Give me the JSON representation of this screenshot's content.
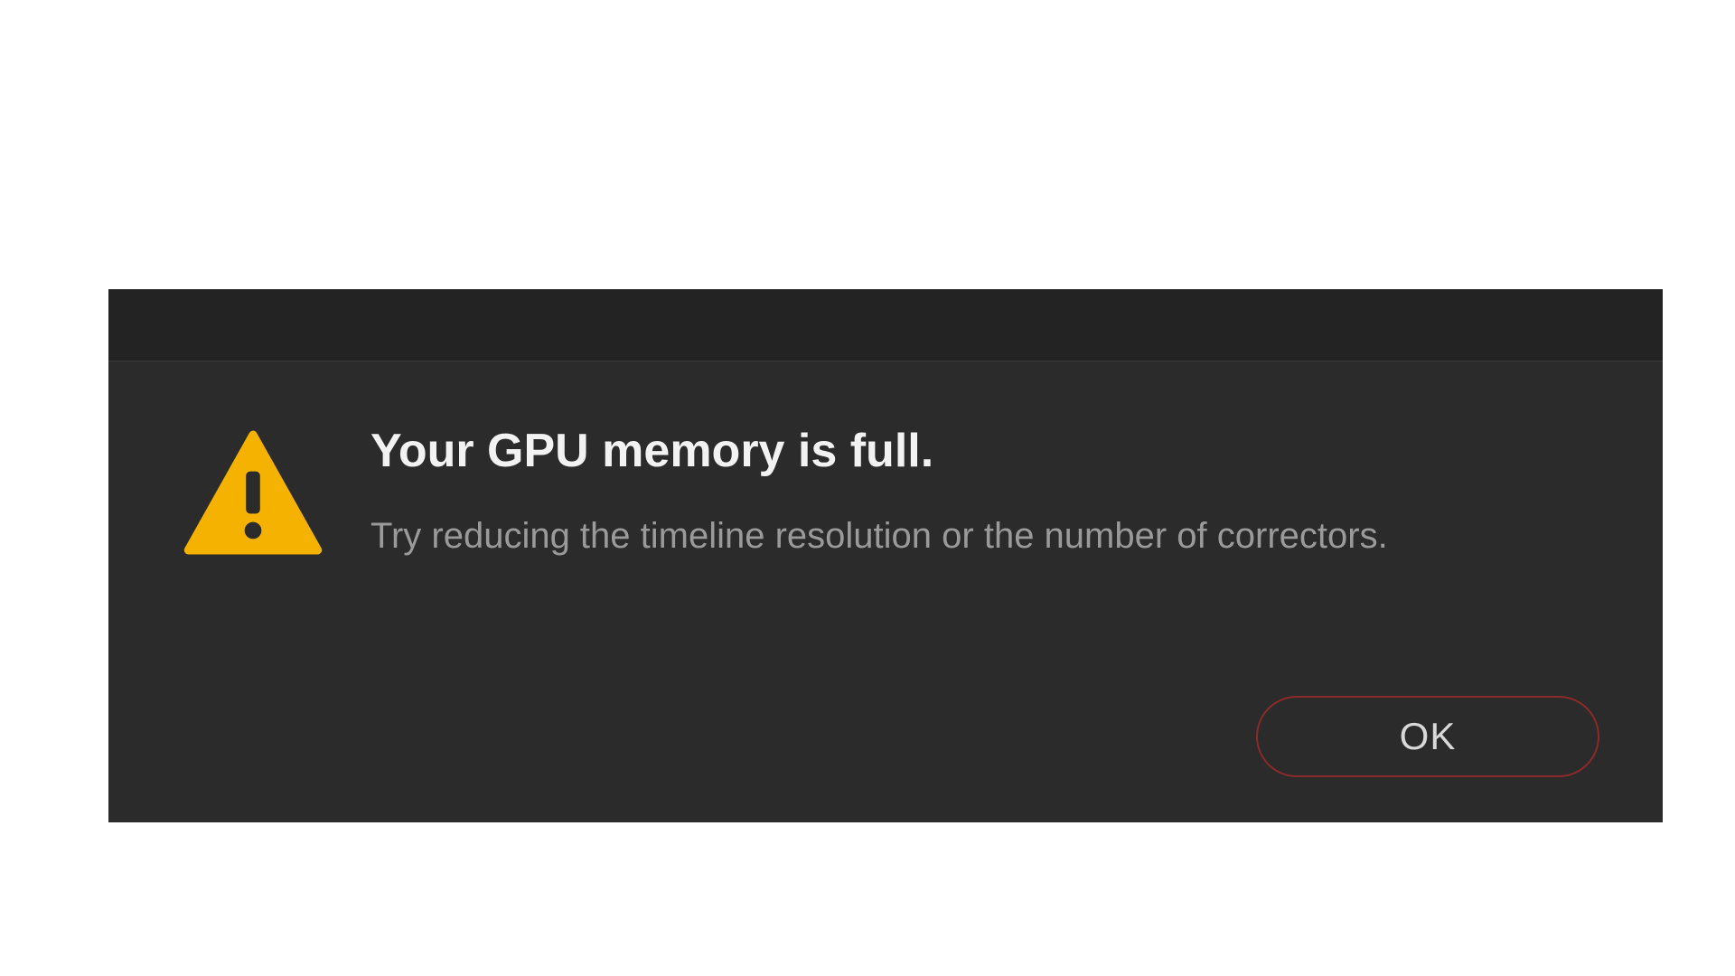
{
  "dialog": {
    "title": "Your GPU memory is full.",
    "message": "Try reducing the timeline resolution or the number of correctors.",
    "ok_label": "OK",
    "icon_name": "warning",
    "colors": {
      "background": "#2b2b2b",
      "titlebar": "#232323",
      "title_text": "#f2f2f2",
      "message_text": "#9a9a9a",
      "button_border": "#8a2a2a",
      "button_text": "#d8d8d8",
      "warning_icon": "#f5b201"
    }
  }
}
